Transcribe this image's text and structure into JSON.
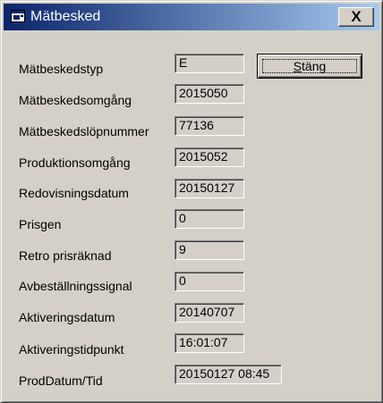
{
  "window": {
    "title": "Mätbesked",
    "close_label": "X",
    "icon": "window-app-icon"
  },
  "buttons": {
    "stang_mnemonic": "S",
    "stang_rest": "täng"
  },
  "fields": [
    {
      "label": "Mätbeskedstyp",
      "value": "E"
    },
    {
      "label": "Mätbeskedsomgång",
      "value": "2015050"
    },
    {
      "label": "Mätbeskedslöpnummer",
      "value": "77136"
    },
    {
      "label": "Produktionsomgång",
      "value": "2015052"
    },
    {
      "label": "Redovisningsdatum",
      "value": "20150127"
    },
    {
      "label": "Prisgen",
      "value": "0"
    },
    {
      "label": "Retro prisräknad",
      "value": "9"
    },
    {
      "label": "Avbeställningssignal",
      "value": "0"
    },
    {
      "label": "Aktiveringsdatum",
      "value": "20140707"
    },
    {
      "label": "Aktiveringstidpunkt",
      "value": "16:01:07"
    },
    {
      "label": "ProdDatum/Tid",
      "value": "20150127 08:45"
    }
  ]
}
